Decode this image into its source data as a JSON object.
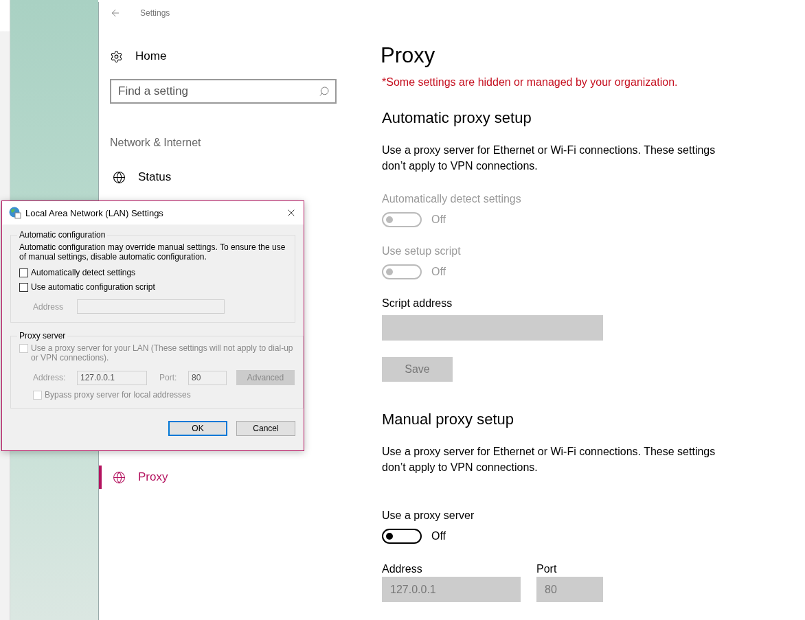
{
  "window": {
    "title": "Settings"
  },
  "sidebar": {
    "home": "Home",
    "search": {
      "placeholder": "Find a setting"
    },
    "section": "Network & Internet",
    "items": [
      {
        "label": "Status",
        "selected": false
      },
      {
        "label": "Proxy",
        "selected": true
      }
    ]
  },
  "page": {
    "title": "Proxy",
    "notice": "*Some settings are hidden or managed by your organization.",
    "automatic": {
      "heading": "Automatic proxy setup",
      "description": "Use a proxy server for Ethernet or Wi-Fi connections. These settings don’t apply to VPN connections.",
      "settings": [
        {
          "label": "Automatically detect settings",
          "on": false,
          "disabled": true,
          "state": "Off"
        },
        {
          "label": "Use setup script",
          "on": false,
          "disabled": true,
          "state": "Off"
        }
      ],
      "script_address": {
        "label": "Script address",
        "disabled": true
      },
      "save": {
        "label": "Save",
        "disabled": true
      }
    },
    "manual": {
      "heading": "Manual proxy setup",
      "description": "Use a proxy server for Ethernet or Wi-Fi connections. These settings don’t apply to VPN connections.",
      "toggle": {
        "label": "Use a proxy server",
        "on": false,
        "disabled": false,
        "state": "Off"
      },
      "address": {
        "label": "Address",
        "value": "127.0.0.1",
        "disabled": true
      },
      "port": {
        "label": "Port",
        "value": "80",
        "disabled": true
      }
    }
  },
  "dialog": {
    "title": "Local Area Network (LAN) Settings",
    "auto_group": {
      "legend": "Automatic configuration",
      "note": "Automatic configuration may override manual settings.  To ensure the use of manual settings, disable automatic configuration.",
      "options": [
        {
          "label": "Automatically detect settings",
          "checked": false,
          "disabled": false
        },
        {
          "label": "Use automatic configuration script",
          "checked": false,
          "disabled": false
        }
      ],
      "address": {
        "label": "Address",
        "disabled": true
      }
    },
    "proxy_group": {
      "legend": "Proxy server",
      "use_proxy": {
        "label": "Use a proxy server for your LAN (These settings will not apply to dial-up or VPN connections).",
        "checked": false,
        "disabled": true
      },
      "address": {
        "label": "Address:",
        "value": "127.0.0.1",
        "disabled": true
      },
      "port": {
        "label": "Port:",
        "value": "80",
        "disabled": true
      },
      "advanced": {
        "label": "Advanced",
        "disabled": true
      },
      "bypass": {
        "label": "Bypass proxy server for local addresses",
        "checked": false,
        "disabled": true
      }
    },
    "buttons": [
      {
        "label": "OK",
        "default": true
      },
      {
        "label": "Cancel",
        "default": false
      }
    ]
  }
}
